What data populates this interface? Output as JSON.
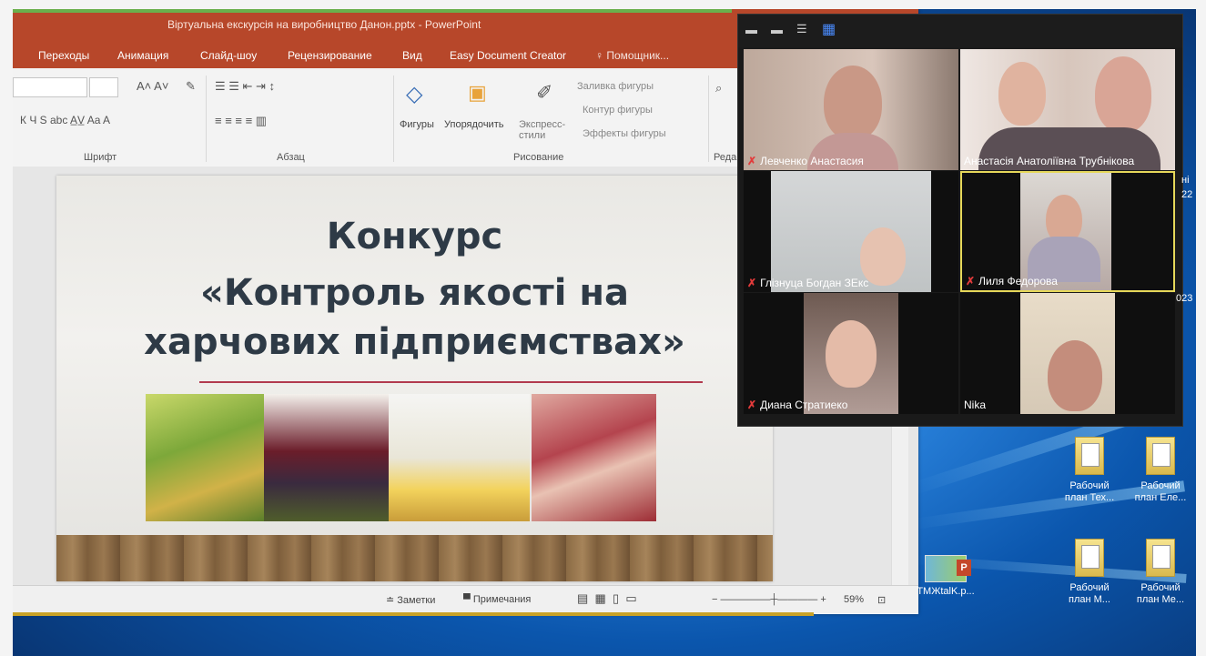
{
  "powerpoint": {
    "window_title": "Віртуальна екскурсія на виробництво Данон.pptx - PowerPoint",
    "tabs": [
      "Переходы",
      "Анимация",
      "Слайд-шоу",
      "Рецензирование",
      "Вид",
      "Easy Document Creator",
      "Помощник..."
    ],
    "ribbon": {
      "font_group": "Шрифт",
      "paragraph_group": "Абзац",
      "drawing_group": "Рисование",
      "edit_group": "Реда",
      "shapes_label": "Фигуры",
      "arrange_label": "Упорядочить",
      "quick_styles_label": "Экспресс-\nстили",
      "shape_fill": "Заливка фигуры",
      "shape_outline": "Контур фигуры",
      "shape_effects": "Эффекты фигуры"
    },
    "slide": {
      "line1": "Конкурс",
      "line2": "«Контроль якості на",
      "line3": "харчових підприємствах»"
    },
    "status": {
      "notes": "Заметки",
      "comments": "Примечания",
      "zoom": "59%"
    }
  },
  "zoom_meeting": {
    "participants": [
      {
        "name": "Левченко Анастасия",
        "muted": true
      },
      {
        "name": "Анастасія Анатоліївна Трубнікова",
        "muted": false
      },
      {
        "name": "Глізнуца Богдан ЗЕкс",
        "muted": true
      },
      {
        "name": "Лиля Федорова",
        "muted": true,
        "active_speaker": true
      },
      {
        "name": "Диана Стратиеко",
        "muted": true
      },
      {
        "name": "Nika",
        "muted": false
      }
    ]
  },
  "desktop": {
    "icons": [
      {
        "label": "Рабочий план Тех...",
        "type": "folder"
      },
      {
        "label": "Рабочий план Еле...",
        "type": "folder"
      },
      {
        "label": "Рабочий план М...",
        "type": "folder"
      },
      {
        "label": "Рабочий план Ме...",
        "type": "folder"
      },
      {
        "label": "ТМЖtalK.p...",
        "type": "pptx"
      }
    ],
    "edge_text": [
      "ні",
      "22",
      "023"
    ]
  },
  "colors": {
    "ppt_accent": "#b7472a",
    "slide_title": "#2e3a46",
    "slide_rule": "#b23a4e",
    "active_speaker_border": "#e6d85a"
  }
}
